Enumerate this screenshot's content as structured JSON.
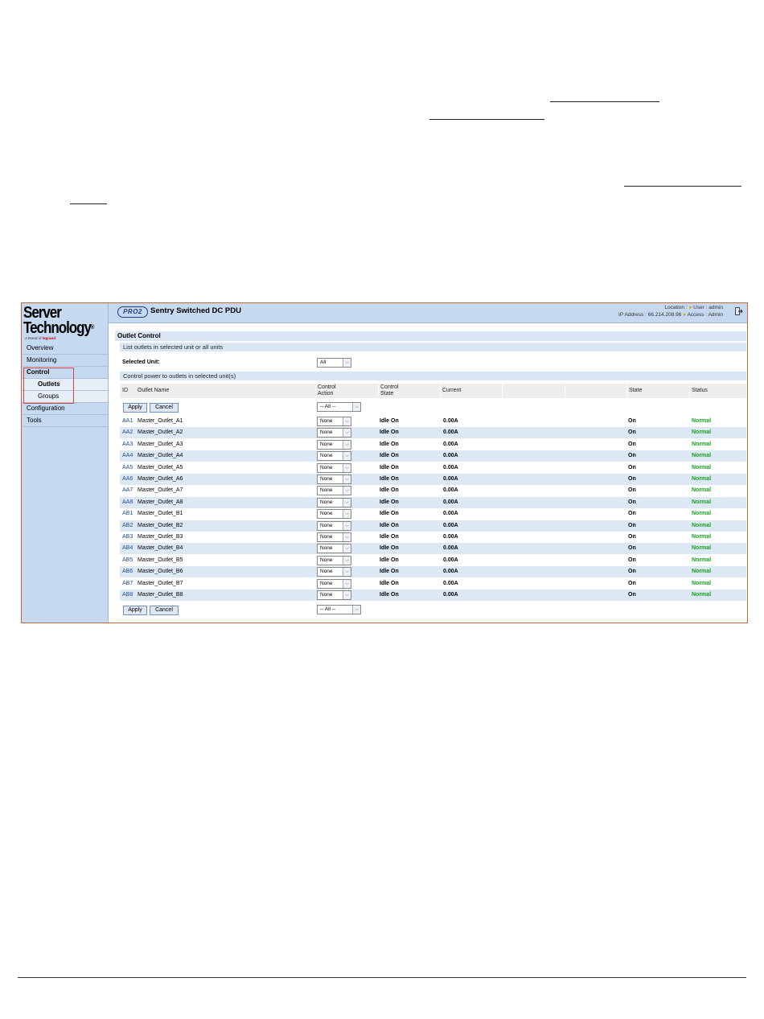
{
  "app": {
    "brand_line1": "Server",
    "brand_line2": "Technology",
    "brand_tagline_prefix": "A brand of",
    "brand_tagline_brand": "legrand",
    "product_badge": "PRO2",
    "product_title": "Sentry Switched DC PDU"
  },
  "header": {
    "location_label": "Location :",
    "user_label": "User : admin",
    "ip_label": "IP Address : 66.214.208.96",
    "access_label": "Access : Admin"
  },
  "sidebar": {
    "items": [
      {
        "label": "Overview"
      },
      {
        "label": "Monitoring"
      },
      {
        "label": "Control"
      },
      {
        "label": "Outlets"
      },
      {
        "label": "Groups"
      },
      {
        "label": "Configuration"
      },
      {
        "label": "Tools"
      }
    ]
  },
  "main": {
    "section_title": "Outlet Control",
    "list_subtitle": "List outlets in selected unit or all units",
    "selected_unit_label": "Selected Unit:",
    "selected_unit_value": "All",
    "control_subtitle": "Control power to outlets in selected unit(s)",
    "columns": {
      "id": "ID",
      "outlet_name": "Outlet Name",
      "control_action_1": "Control",
      "control_action_2": "Action",
      "control_state_1": "Control",
      "control_state_2": "State",
      "current": "Current",
      "state": "State",
      "status": "Status"
    },
    "apply_label": "Apply",
    "cancel_label": "Cancel",
    "all_action_value": "-- All --",
    "rows": [
      {
        "id": "AA1",
        "name": "Master_Outlet_A1",
        "action": "None",
        "control_state": "Idle On",
        "current": "0.00A",
        "state": "On",
        "status": "Normal"
      },
      {
        "id": "AA2",
        "name": "Master_Outlet_A2",
        "action": "None",
        "control_state": "Idle On",
        "current": "0.00A",
        "state": "On",
        "status": "Normal"
      },
      {
        "id": "AA3",
        "name": "Master_Outlet_A3",
        "action": "None",
        "control_state": "Idle On",
        "current": "0.00A",
        "state": "On",
        "status": "Normal"
      },
      {
        "id": "AA4",
        "name": "Master_Outlet_A4",
        "action": "None",
        "control_state": "Idle On",
        "current": "0.00A",
        "state": "On",
        "status": "Normal"
      },
      {
        "id": "AA5",
        "name": "Master_Outlet_A5",
        "action": "None",
        "control_state": "Idle On",
        "current": "0.00A",
        "state": "On",
        "status": "Normal"
      },
      {
        "id": "AA6",
        "name": "Master_Outlet_A6",
        "action": "None",
        "control_state": "Idle On",
        "current": "0.00A",
        "state": "On",
        "status": "Normal"
      },
      {
        "id": "AA7",
        "name": "Master_Outlet_A7",
        "action": "None",
        "control_state": "Idle On",
        "current": "0.00A",
        "state": "On",
        "status": "Normal"
      },
      {
        "id": "AA8",
        "name": "Master_Outlet_A8",
        "action": "None",
        "control_state": "Idle On",
        "current": "0.00A",
        "state": "On",
        "status": "Normal"
      },
      {
        "id": "AB1",
        "name": "Master_Outlet_B1",
        "action": "None",
        "control_state": "Idle On",
        "current": "0.00A",
        "state": "On",
        "status": "Normal"
      },
      {
        "id": "AB2",
        "name": "Master_Outlet_B2",
        "action": "None",
        "control_state": "Idle On",
        "current": "0.00A",
        "state": "On",
        "status": "Normal"
      },
      {
        "id": "AB3",
        "name": "Master_Outlet_B3",
        "action": "None",
        "control_state": "Idle On",
        "current": "0.00A",
        "state": "On",
        "status": "Normal"
      },
      {
        "id": "AB4",
        "name": "Master_Outlet_B4",
        "action": "None",
        "control_state": "Idle On",
        "current": "0.00A",
        "state": "On",
        "status": "Normal"
      },
      {
        "id": "AB5",
        "name": "Master_Outlet_B5",
        "action": "None",
        "control_state": "Idle On",
        "current": "0.00A",
        "state": "On",
        "status": "Normal"
      },
      {
        "id": "AB6",
        "name": "Master_Outlet_B6",
        "action": "None",
        "control_state": "Idle On",
        "current": "0.00A",
        "state": "On",
        "status": "Normal"
      },
      {
        "id": "AB7",
        "name": "Master_Outlet_B7",
        "action": "None",
        "control_state": "Idle On",
        "current": "0.00A",
        "state": "On",
        "status": "Normal"
      },
      {
        "id": "AB8",
        "name": "Master_Outlet_B8",
        "action": "None",
        "control_state": "Idle On",
        "current": "0.00A",
        "state": "On",
        "status": "Normal"
      }
    ]
  },
  "icons": {
    "logout": "logout-icon",
    "dropdown": "chevron-down-icon"
  },
  "colors": {
    "sidebar_bg": "#c5d9f1",
    "row_alt": "#dde8f5",
    "status_normal": "#1aa020",
    "id_link": "#1a4a9c",
    "highlight_box": "#e04040",
    "frame_border": "#c0673a"
  }
}
